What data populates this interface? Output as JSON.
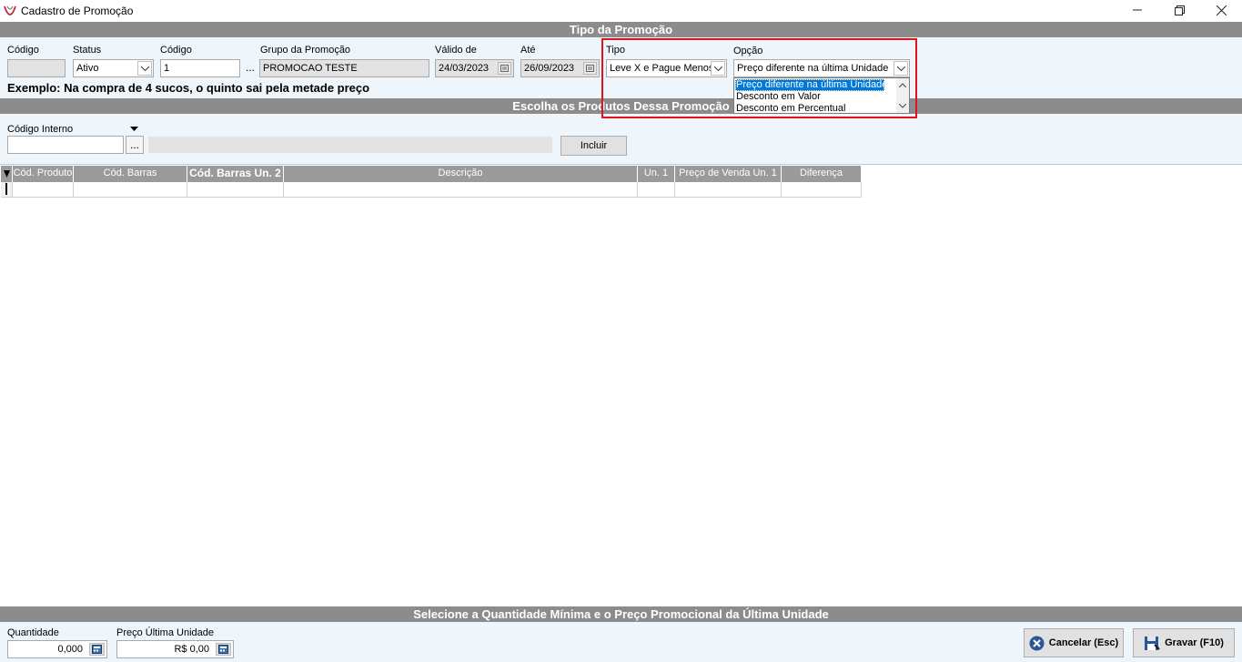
{
  "window": {
    "title": "Cadastro de Promoção"
  },
  "sections": {
    "tipo": "Tipo da Promoção",
    "produtos": "Escolha os Produtos Dessa Promoção",
    "quantidade": "Selecione a Quantidade Mínima e o Preço Promocional da Última Unidade"
  },
  "form": {
    "codigo_label": "Código",
    "codigo_value": "",
    "status_label": "Status",
    "status_value": "Ativo",
    "codigo2_label": "Código",
    "codigo2_value": "1",
    "dots": "...",
    "grupo_label": "Grupo da Promoção",
    "grupo_value": "PROMOCAO TESTE",
    "valido_label": "Válido de",
    "valido_value": "24/03/2023",
    "ate_label": "Até",
    "ate_value": "26/09/2023",
    "tipo_label": "Tipo",
    "tipo_value": "Leve X e Pague Menos",
    "opcao_label": "Opção",
    "opcao_value": "Preço diferente na última Unidade",
    "opcao_options": [
      "Preço diferente na última Unidade",
      "Desconto em Valor",
      "Desconto em Percentual"
    ],
    "example": "Exemplo: Na compra de 4 sucos, o quinto sai pela metade preço"
  },
  "produtos": {
    "codigo_interno_label": "Código Interno",
    "codigo_interno_value": "",
    "descricao_value": "",
    "incluir_label": "Incluir"
  },
  "grid": {
    "columns": [
      "Cód. Produto",
      "Cód. Barras",
      "Cód. Barras Un. 2",
      "Descrição",
      "Un. 1",
      "Preço de Venda Un. 1",
      "Diferença"
    ]
  },
  "bottom": {
    "quantidade_label": "Quantidade",
    "quantidade_value": "0,000",
    "preco_label": "Preço Última Unidade",
    "preco_value": "R$ 0,00",
    "cancelar_label": "Cancelar (Esc)",
    "gravar_label": "Gravar (F10)"
  },
  "colors": {
    "section_header": "#8c8c8c",
    "panel_bg": "#eef5fb",
    "selection": "#0078d7",
    "highlight": "#e0141e"
  }
}
